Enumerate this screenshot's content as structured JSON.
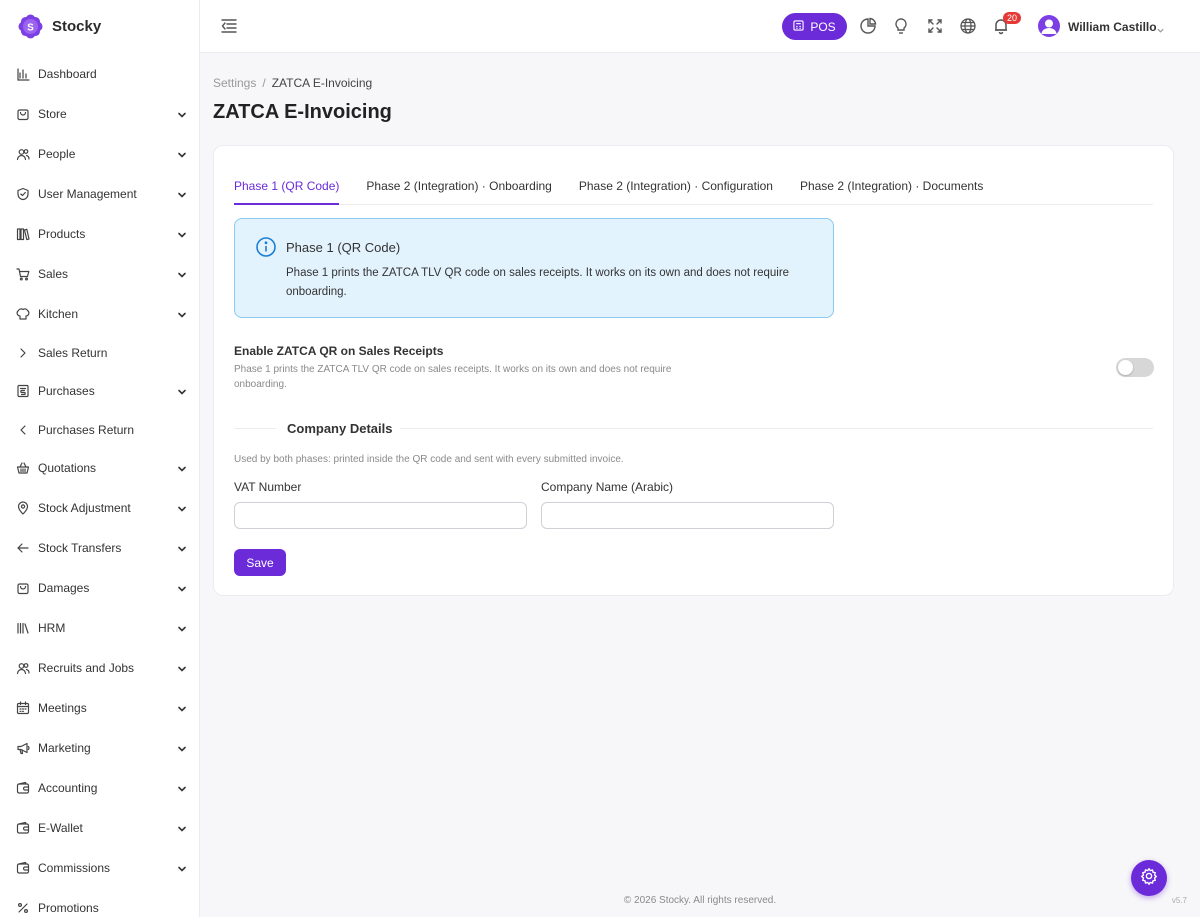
{
  "brand": {
    "name": "Stocky",
    "accent": "#6c2bd9"
  },
  "sidebar": {
    "items": [
      {
        "label": "Dashboard",
        "icon": "chart-bar-icon",
        "has_chevron": false
      },
      {
        "label": "Store",
        "icon": "shopping-bag-icon",
        "has_chevron": true
      },
      {
        "label": "People",
        "icon": "users-icon",
        "has_chevron": true
      },
      {
        "label": "User Management",
        "icon": "shield-check-icon",
        "has_chevron": true
      },
      {
        "label": "Products",
        "icon": "books-icon",
        "has_chevron": true
      },
      {
        "label": "Sales",
        "icon": "cart-icon",
        "has_chevron": true
      },
      {
        "label": "Kitchen",
        "icon": "chef-hat-icon",
        "has_chevron": true
      },
      {
        "label": "Sales Return",
        "icon": "chevron-right-icon",
        "has_chevron": false
      },
      {
        "label": "Purchases",
        "icon": "receipt-icon",
        "has_chevron": true
      },
      {
        "label": "Purchases Return",
        "icon": "chevron-left-icon",
        "has_chevron": false
      },
      {
        "label": "Quotations",
        "icon": "basket-icon",
        "has_chevron": true
      },
      {
        "label": "Stock Adjustment",
        "icon": "map-pin-icon",
        "has_chevron": true
      },
      {
        "label": "Stock Transfers",
        "icon": "arrow-left-icon",
        "has_chevron": true
      },
      {
        "label": "Damages",
        "icon": "shopping-bag-icon",
        "has_chevron": true
      },
      {
        "label": "HRM",
        "icon": "library-icon",
        "has_chevron": true
      },
      {
        "label": "Recruits and Jobs",
        "icon": "users-icon",
        "has_chevron": true
      },
      {
        "label": "Meetings",
        "icon": "calendar-icon",
        "has_chevron": true
      },
      {
        "label": "Marketing",
        "icon": "megaphone-icon",
        "has_chevron": true
      },
      {
        "label": "Accounting",
        "icon": "wallet-icon",
        "has_chevron": true
      },
      {
        "label": "E-Wallet",
        "icon": "wallet-icon",
        "has_chevron": true
      },
      {
        "label": "Commissions",
        "icon": "wallet-icon",
        "has_chevron": true
      },
      {
        "label": "Promotions",
        "icon": "percent-icon",
        "has_chevron": false
      }
    ]
  },
  "header": {
    "pos_label": "POS",
    "notifications_count": "20",
    "user_name": "William Castillo"
  },
  "breadcrumb": {
    "parent": "Settings",
    "current": "ZATCA E-Invoicing"
  },
  "page": {
    "title": "ZATCA E-Invoicing"
  },
  "tabs": [
    {
      "label": "Phase 1 (QR Code)",
      "active": true
    },
    {
      "label": "Phase 2 (Integration) · Onboarding",
      "active": false
    },
    {
      "label": "Phase 2 (Integration) · Configuration",
      "active": false
    },
    {
      "label": "Phase 2 (Integration) · Documents",
      "active": false
    }
  ],
  "info": {
    "title": "Phase 1 (QR Code)",
    "text": "Phase 1 prints the ZATCA TLV QR code on sales receipts. It works on its own and does not require onboarding."
  },
  "setting": {
    "label": "Enable ZATCA QR on Sales Receipts",
    "help": "Phase 1 prints the ZATCA TLV QR code on sales receipts. It works on its own and does not require onboarding.",
    "enabled": false
  },
  "company": {
    "title": "Company Details",
    "help": "Used by both phases: printed inside the QR code and sent with every submitted invoice.",
    "vat_label": "VAT Number",
    "vat_value": "",
    "name_ar_label": "Company Name (Arabic)",
    "name_ar_value": "",
    "save_label": "Save"
  },
  "footer": {
    "copyright": "© 2026 Stocky. All rights reserved.",
    "version": "v5.7"
  }
}
